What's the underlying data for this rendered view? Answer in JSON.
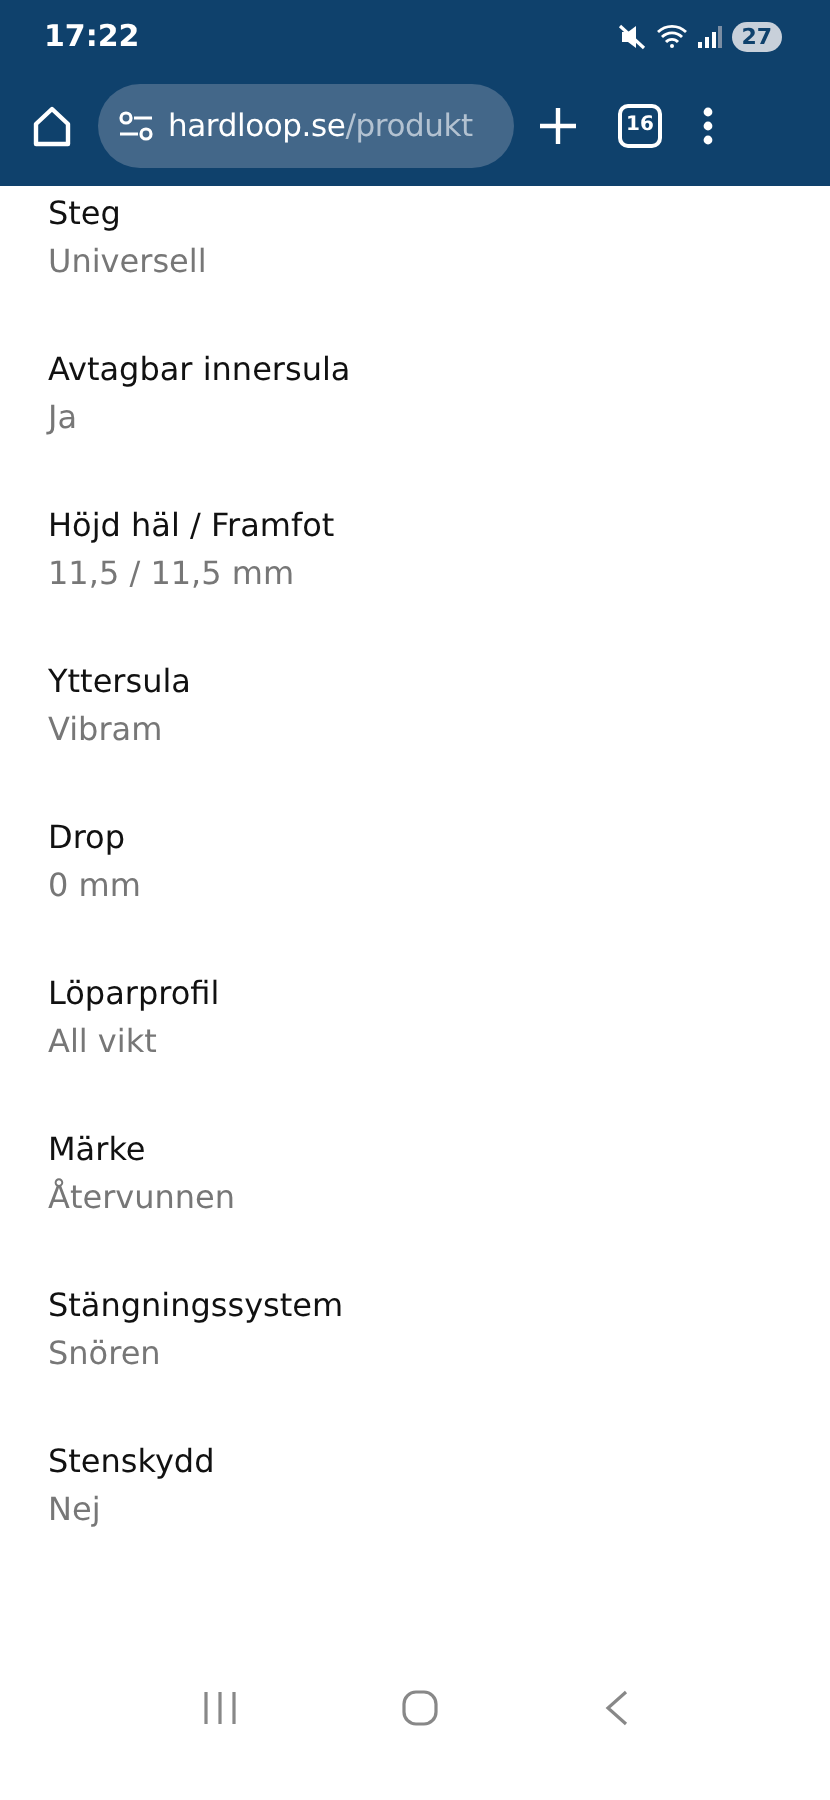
{
  "status_bar": {
    "time": "17:22",
    "battery": "27"
  },
  "browser": {
    "url_domain": "hardloop.se",
    "url_path": "/produkt",
    "tab_count": "16"
  },
  "specs": [
    {
      "label": "Steg",
      "value": "Universell"
    },
    {
      "label": "Avtagbar innersula",
      "value": "Ja"
    },
    {
      "label": "Höjd häl / Framfot",
      "value": "11,5 / 11,5 mm"
    },
    {
      "label": "Yttersula",
      "value": "Vibram"
    },
    {
      "label": "Drop",
      "value": "0 mm"
    },
    {
      "label": "Löparprofil",
      "value": "All vikt"
    },
    {
      "label": "Märke",
      "value": "Återvunnen"
    },
    {
      "label": "Stängningssystem",
      "value": "Snören"
    },
    {
      "label": "Stenskydd",
      "value": "Nej"
    }
  ]
}
